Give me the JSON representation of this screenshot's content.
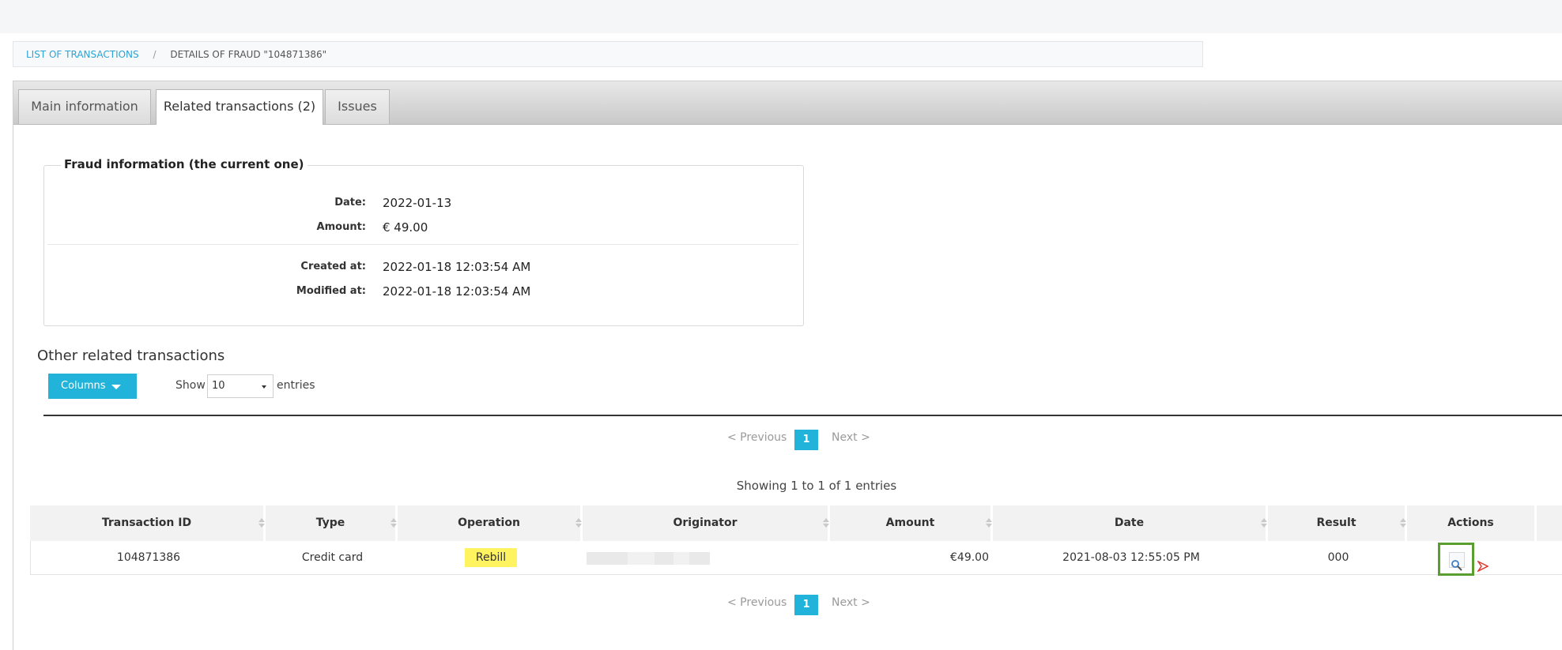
{
  "breadcrumb": {
    "list_link": "LIST OF TRANSACTIONS",
    "separator": "/",
    "current": "DETAILS OF FRAUD \"104871386\""
  },
  "tabs": [
    {
      "label": "Main information",
      "active": false
    },
    {
      "label": "Related transactions (2)",
      "active": true
    },
    {
      "label": "Issues",
      "active": false
    }
  ],
  "fraud_info": {
    "legend": "Fraud information (the current one)",
    "date_label": "Date:",
    "date_value": "2022-01-13",
    "amount_label": "Amount:",
    "amount_value": "€ 49.00",
    "created_label": "Created at:",
    "created_value": "2022-01-18 12:03:54 AM",
    "modified_label": "Modified at:",
    "modified_value": "2022-01-18 12:03:54 AM"
  },
  "related": {
    "title": "Other related transactions",
    "columns_button": "Columns",
    "show_label": "Show",
    "page_length": "10",
    "entries_label": "entries",
    "showing": "Showing 1 to 1 of 1 entries"
  },
  "pagination": {
    "previous": "< Previous",
    "page": "1",
    "next": "Next >"
  },
  "table": {
    "headers": [
      "Transaction ID",
      "Type",
      "Operation",
      "Originator",
      "Amount",
      "Date",
      "Result",
      "Actions"
    ],
    "rows": [
      {
        "transaction_id": "104871386",
        "type": "Credit card",
        "operation": "Rebill",
        "amount": "€49.00",
        "date": "2021-08-03 12:55:05 PM",
        "result": "000"
      }
    ]
  },
  "colors": {
    "accent": "#21b3d9",
    "link": "#2aa4d5",
    "highlight": "#fff35f",
    "focus_border": "#5a9e2f"
  },
  "icons": {
    "view": "magnifier-icon",
    "export": "send-arrow-icon"
  }
}
